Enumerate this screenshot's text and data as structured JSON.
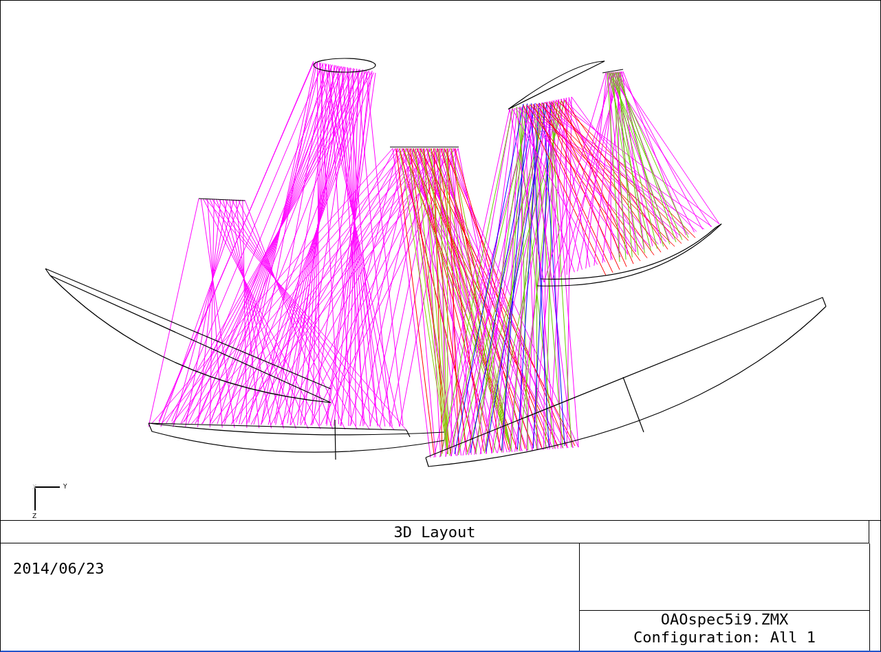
{
  "plot": {
    "title": "3D Layout",
    "axes": {
      "x": "X",
      "y": "Y",
      "z": "Z"
    }
  },
  "footer": {
    "date": "2014/06/23",
    "file": "OAOspec5i9.ZMX",
    "configuration": "Configuration: All 1"
  }
}
